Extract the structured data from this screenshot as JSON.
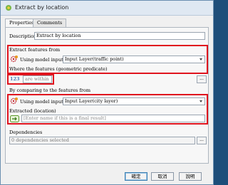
{
  "window": {
    "title": "Extract by location"
  },
  "tabs": [
    "Properties",
    "Comments"
  ],
  "description": {
    "label": "Description",
    "value": "Extract by location"
  },
  "extract_features": {
    "heading": "Extract features from",
    "source_label": "Using model input",
    "combo_value": "Input Layer(traffic point)"
  },
  "predicate": {
    "heading": "Where the features (geometric predicate)",
    "value_icon": "123",
    "value": "are within",
    "more_button": "..."
  },
  "comparison": {
    "heading": "By comparing to the features from",
    "source_label": "Using model input",
    "combo_value": "Input Layer(city layer)"
  },
  "extracted": {
    "heading": "Extracted (location)",
    "placeholder": "[Enter name if this is a final result]"
  },
  "dependencies": {
    "label": "Dependencies",
    "value": "0 dependencies selected",
    "more_button": "..."
  },
  "buttons": {
    "ok": "確定",
    "cancel": "取消",
    "help": "說明"
  },
  "colors": {
    "highlight": "#e0141e",
    "title_bar": "#dfe8f2"
  },
  "icons": [
    "qgis-icon",
    "model-input-gear-icon",
    "number-123-icon",
    "output-arrow-icon"
  ]
}
